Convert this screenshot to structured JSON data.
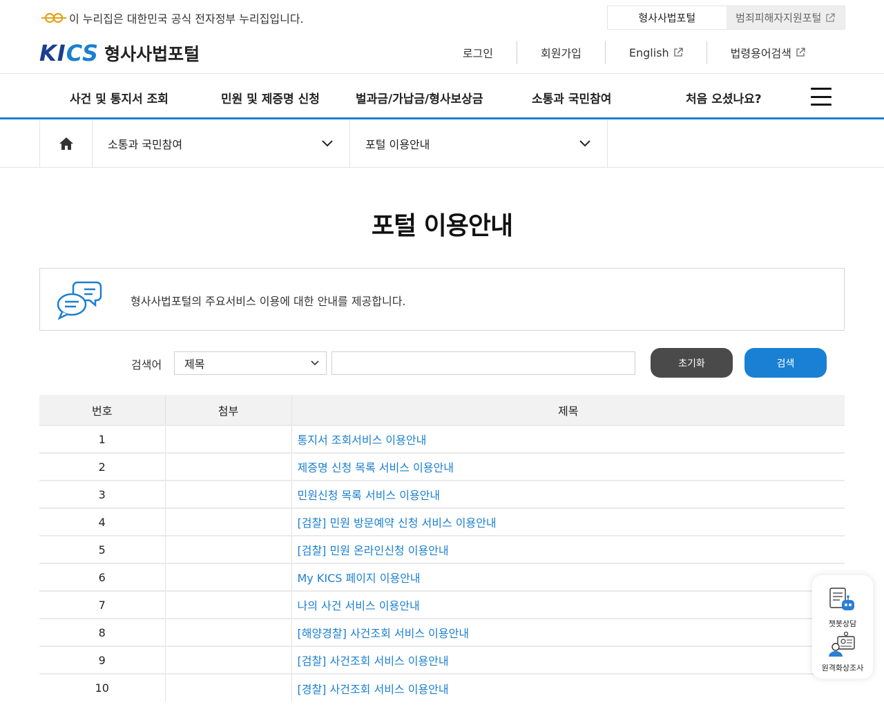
{
  "gov_banner": {
    "text": "이 누리집은 대한민국 공식 전자정부 누리집입니다."
  },
  "portal_switch": [
    {
      "label": "형사사법포털"
    },
    {
      "label": "범죄피해자지원포털"
    }
  ],
  "logo": {
    "kics_prefix": "KI",
    "kics_suffix": "CS",
    "name": "형사사법포털"
  },
  "util_menu": [
    {
      "label": "로그인"
    },
    {
      "label": "회원가입"
    },
    {
      "label": "English"
    },
    {
      "label": "법령용어검색"
    }
  ],
  "gnb": [
    {
      "label": "사건 및 통지서 조회"
    },
    {
      "label": "민원 및 제증명 신청"
    },
    {
      "label": "벌과금/가납금/형사보상금"
    },
    {
      "label": "소통과 국민참여"
    },
    {
      "label": "처음 오셨나요?"
    }
  ],
  "breadcrumb": {
    "level1": "소통과 국민참여",
    "level2": "포털 이용안내"
  },
  "page_title": "포털 이용안내",
  "intro_text": "형사사법포털의 주요서비스 이용에 대한 안내를 제공합니다.",
  "search": {
    "label": "검색어",
    "selected_option": "제목",
    "input_value": "",
    "reset_label": "초기화",
    "search_label": "검색"
  },
  "table": {
    "headers": [
      "번호",
      "첨부",
      "제목"
    ],
    "rows": [
      {
        "no": "1",
        "attach": "",
        "title": "통지서 조회서비스 이용안내"
      },
      {
        "no": "2",
        "attach": "",
        "title": "제증명 신청 목록 서비스 이용안내"
      },
      {
        "no": "3",
        "attach": "",
        "title": "민원신청 목록 서비스 이용안내"
      },
      {
        "no": "4",
        "attach": "",
        "title": "[검찰] 민원 방문예약 신청 서비스 이용안내"
      },
      {
        "no": "5",
        "attach": "",
        "title": "[검찰] 민원 온라인신청 이용안내"
      },
      {
        "no": "6",
        "attach": "",
        "title": "My KICS 페이지 이용안내"
      },
      {
        "no": "7",
        "attach": "",
        "title": "나의 사건 서비스 이용안내"
      },
      {
        "no": "8",
        "attach": "",
        "title": "[해양경찰] 사건조회 서비스 이용안내"
      },
      {
        "no": "9",
        "attach": "",
        "title": "[검찰] 사건조회 서비스 이용안내"
      },
      {
        "no": "10",
        "attach": "",
        "title": "[경찰] 사건조회 서비스 이용안내"
      }
    ]
  },
  "floating": {
    "chatbot_label": "챗봇상담",
    "video_label": "원격화상조사"
  },
  "colors": {
    "brand_blue": "#1a7fd0",
    "brand_navy": "#1a3f8f",
    "reset_button": "#4a4a4a",
    "search_button": "#1a80d3"
  }
}
